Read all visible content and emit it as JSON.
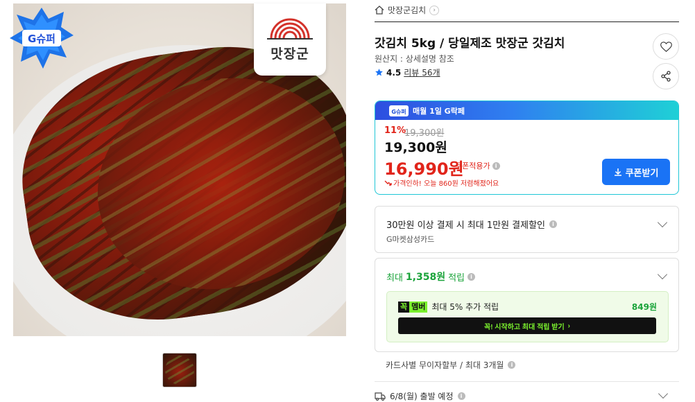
{
  "image": {
    "badge_text": "G슈퍼",
    "brand_logo_text": "맛장군",
    "thumbnail_count": 1
  },
  "breadcrumb": {
    "store_name": "맛장군김치"
  },
  "product": {
    "title": "갓김치 5kg / 당일제조 맛장군 갓김치",
    "origin": "원산지 : 상세설명 참조",
    "rating": "4.5",
    "review_label": "리뷰",
    "review_count": "56개"
  },
  "deal": {
    "header_badge": "G슈퍼",
    "header_text": "매월 1일 G락페",
    "discount_rate": "11%",
    "original_price": "19,300원",
    "sale_price": "19,300원",
    "coupon_price": "16,990원",
    "coupon_applied_label": "쿠폰적용가",
    "price_drop_text": "가격인하! 오늘 860원 저렴해졌어요",
    "coupon_button_label": "쿠폰받기"
  },
  "card_discount": {
    "title": "30만원 이상 결제 시 최대 1만원 결제할인",
    "subtitle": "G마켓삼성카드"
  },
  "points": {
    "prefix": "최대",
    "amount": "1,358원",
    "suffix": "적립",
    "club_badge_a": "꼭",
    "club_badge_b": "멤버",
    "club_text": "최대 5% 추가 적립",
    "club_points": "849원",
    "club_button_label": "꼭! 시작하고 최대 적립 받기"
  },
  "installment": {
    "text": "카드사별 무이자할부 / 최대 3개월"
  },
  "shipping": {
    "text": "6/8(월) 출발 예정"
  },
  "colors": {
    "accent_blue": "#1a73f5",
    "sale_red": "#e1251b",
    "points_green": "#1aa33a",
    "club_green": "#7bf12e"
  }
}
